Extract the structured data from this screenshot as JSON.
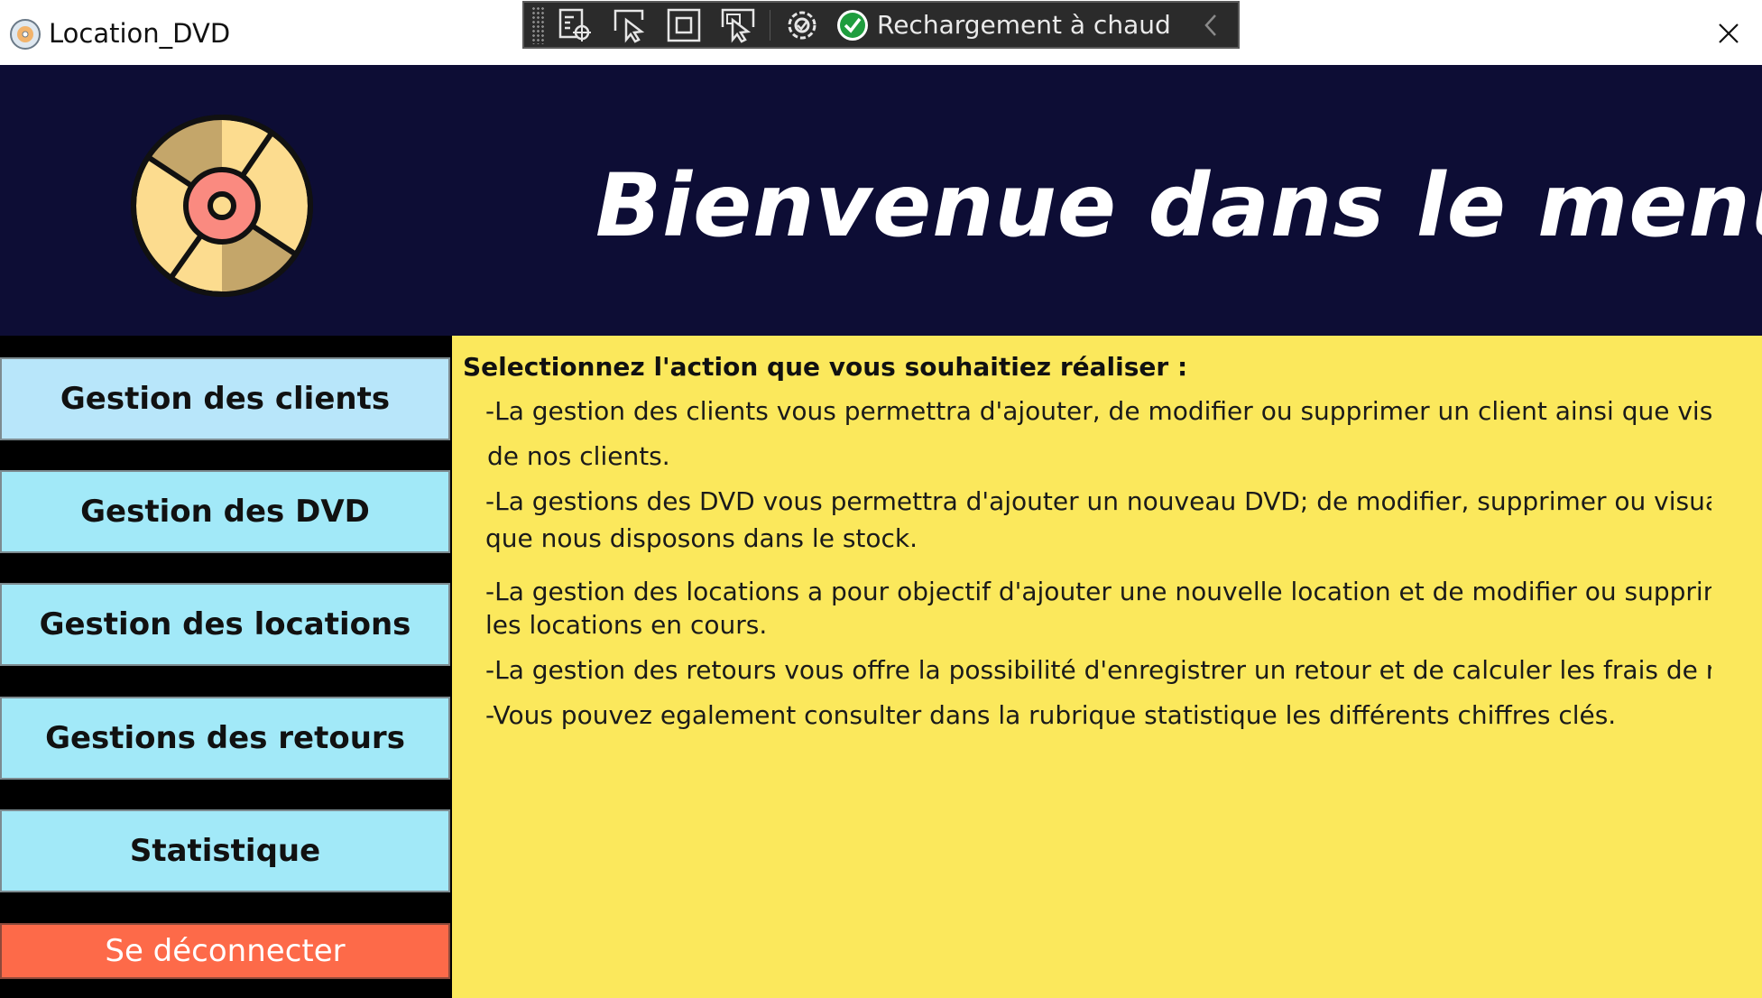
{
  "window": {
    "title": "Location_DVD",
    "app_icon": "dvd-disc-icon",
    "close_icon": "close-icon"
  },
  "dev_toolbar": {
    "tools": [
      "live-visual-tree-icon",
      "select-element-icon",
      "display-layout-adorners-icon",
      "track-focus-icon",
      "binding-failures-icon"
    ],
    "hot_reload_label": "Rechargement à chaud",
    "hot_reload_icon": "checkmark-circle-icon",
    "collapse_icon": "chevron-left-icon"
  },
  "header": {
    "logo": "dvd-disc-logo",
    "welcome": "Bienvenue dans le menu"
  },
  "sidebar": {
    "clients": "Gestion des clients",
    "dvd": "Gestion des DVD",
    "locations": "Gestion des locations",
    "retours": "Gestions des retours",
    "statistique": "Statistique",
    "logout": "Se déconnecter"
  },
  "content": {
    "intro": "Selectionnez l'action que vous souhaitiez réaliser :",
    "clients_line1": "-La gestion des clients vous permettra d'ajouter, de modifier ou supprimer un client ainsi que visualiser",
    "clients_line2": "de nos clients.",
    "dvd_line1": "-La gestions des DVD vous permettra d'ajouter un nouveau DVD; de modifier, supprimer ou visualiser c",
    "dvd_line2": "que nous disposons dans le stock.",
    "locations_line1": "-La gestion des locations a pour objectif d'ajouter une nouvelle location et de modifier ou supprimer et",
    "locations_line2": "les locations en cours.",
    "retours_line": "-La gestion des retours vous offre la possibilité d'enregistrer un retour et de calculer les frais de retard.",
    "stats_line": "-Vous pouvez egalement consulter dans la rubrique statistique les différents chiffres clés."
  },
  "colors": {
    "header_bg": "#0d0d35",
    "content_bg": "#fbe85c",
    "nav_light": "#b8e6fa",
    "nav_cyan": "#a2e9f8",
    "logout_bg": "#fd6a49"
  }
}
